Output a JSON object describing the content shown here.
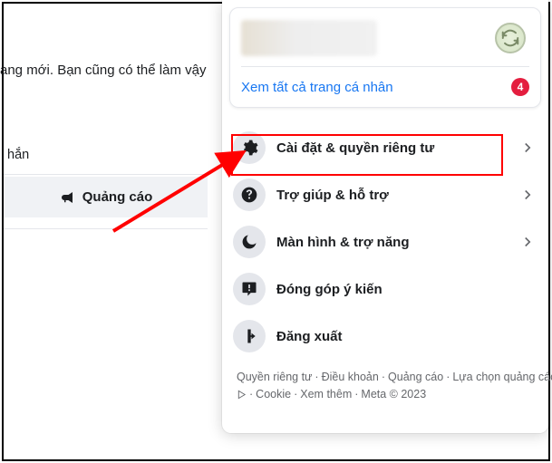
{
  "background": {
    "partial_text_1": "rang mới. Bạn cũng có thể làm vậy",
    "partial_text_2": "hắn",
    "button_label": "Quảng cáo"
  },
  "profile": {
    "see_all_label": "Xem tất cả trang cá nhân",
    "badge_count": "4"
  },
  "menu": {
    "settings": "Cài đặt & quyền riêng tư",
    "help": "Trợ giúp & hỗ trợ",
    "display": "Màn hình & trợ năng",
    "feedback": "Đóng góp ý kiến",
    "logout": "Đăng xuất"
  },
  "footer": {
    "privacy": "Quyền riêng tư",
    "terms": "Điều khoản",
    "ads": "Quảng cáo",
    "ad_choices": "Lựa chọn quảng cáo",
    "cookie": "Cookie",
    "more": "Xem thêm",
    "meta": "Meta © 2023"
  }
}
